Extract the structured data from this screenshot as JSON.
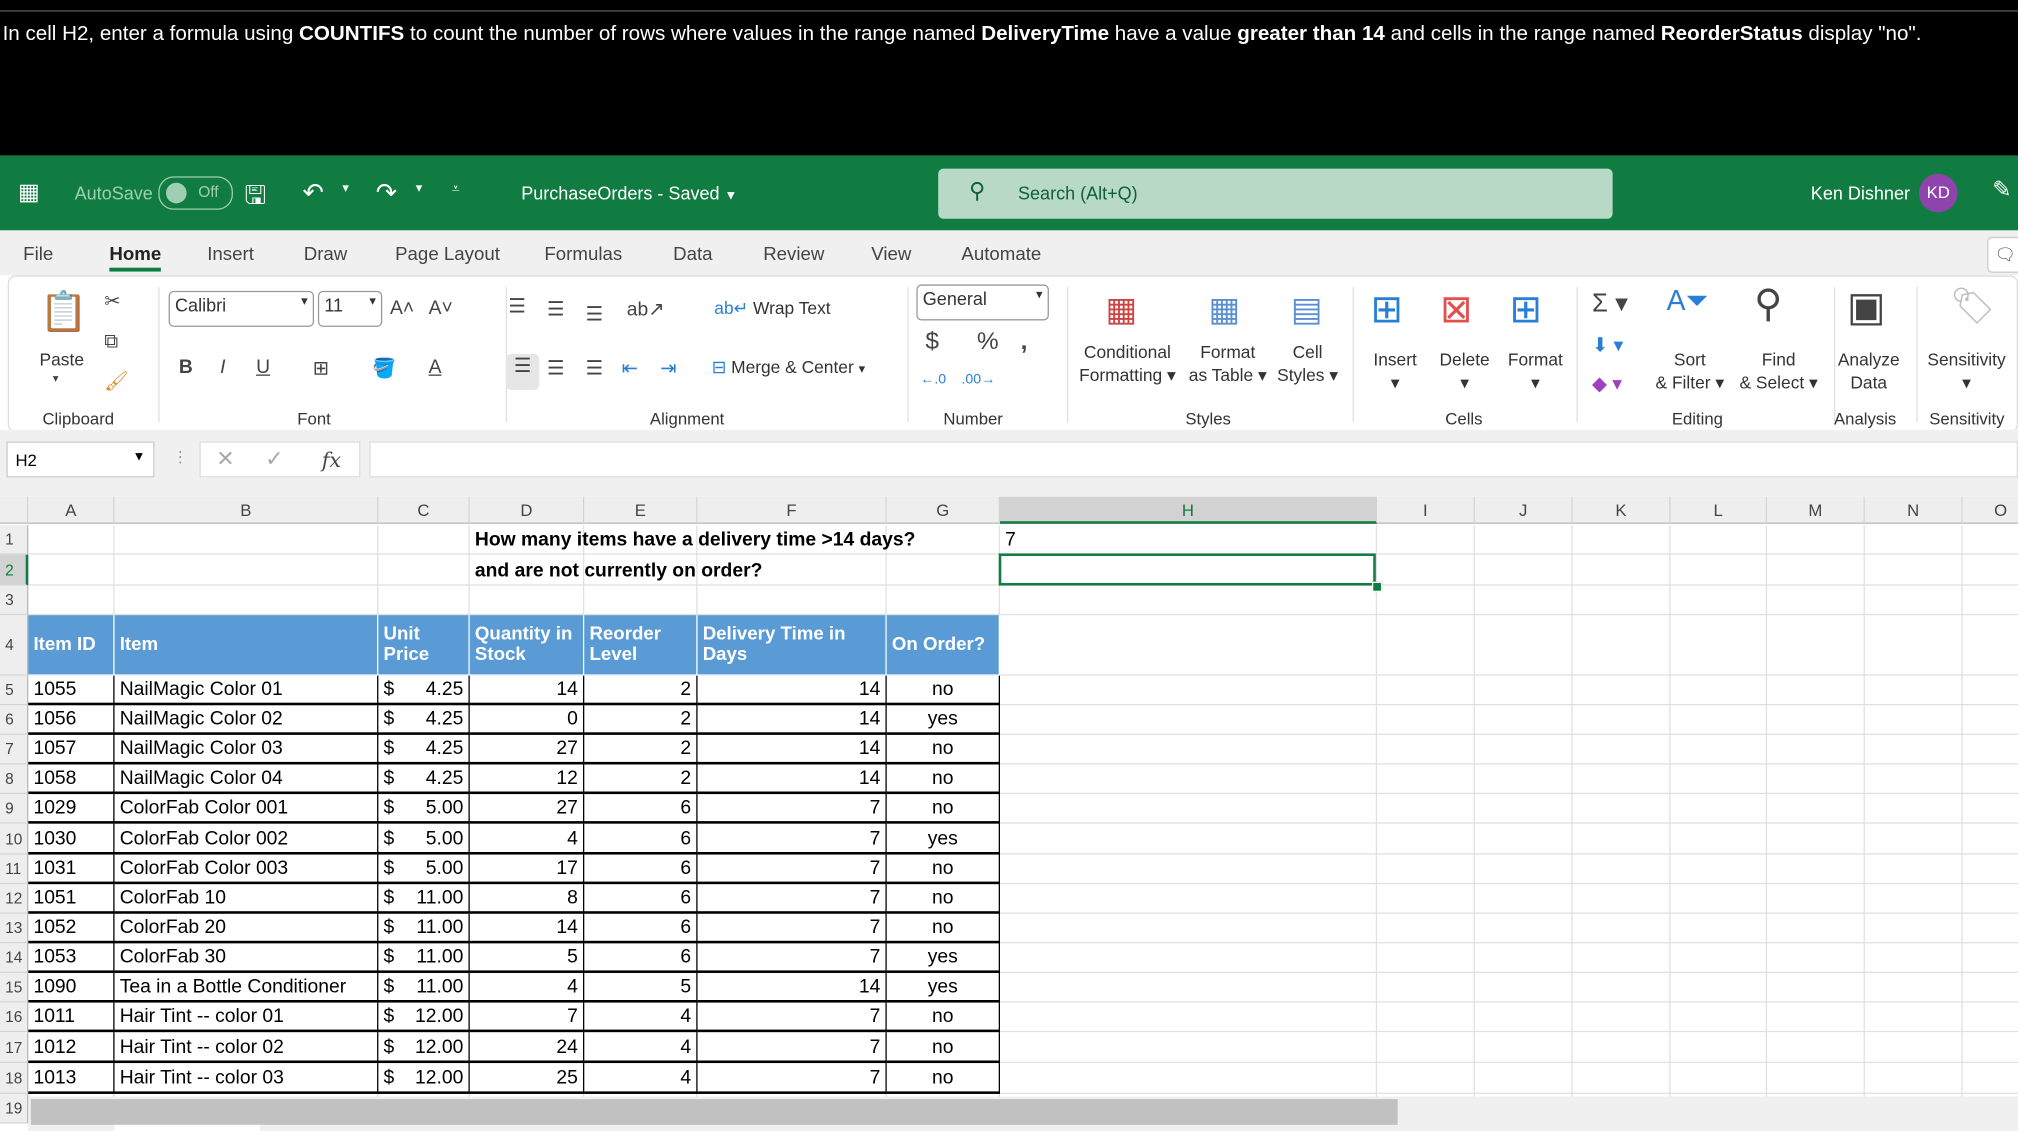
{
  "instruction": {
    "parts": [
      {
        "t": "In cell H2, enter a formula using ",
        "b": false
      },
      {
        "t": "COUNTIFS",
        "b": true
      },
      {
        "t": " to count the number of rows where values in the range named ",
        "b": false
      },
      {
        "t": "DeliveryTime",
        "b": true
      },
      {
        "t": " have a value ",
        "b": false
      },
      {
        "t": "greater than 14",
        "b": true
      },
      {
        "t": " and cells in the range named ",
        "b": false
      },
      {
        "t": "ReorderStatus",
        "b": true
      },
      {
        "t": " display \"no\".",
        "b": false
      }
    ]
  },
  "titlebar": {
    "autosave": "AutoSave",
    "autosave_state": "Off",
    "doc_title": "PurchaseOrders - Saved",
    "search_placeholder": "Search (Alt+Q)",
    "user": "Ken Dishner",
    "initials": "KD",
    "brand": "#107C41"
  },
  "tabs": [
    "File",
    "Home",
    "Insert",
    "Draw",
    "Page Layout",
    "Formulas",
    "Data",
    "Review",
    "View",
    "Automate"
  ],
  "active_tab": "Home",
  "ribbon": {
    "paste": "Paste",
    "font": "Calibri",
    "size": "11",
    "wrap": "Wrap Text",
    "merge": "Merge & Center",
    "numfmt": "General",
    "cond1": "Conditional",
    "cond2": "Formatting",
    "fat1": "Format",
    "fat2": "as Table",
    "cs1": "Cell",
    "cs2": "Styles",
    "insert": "Insert",
    "delete": "Delete",
    "format": "Format",
    "sort1": "Sort",
    "sort2": "& Filter",
    "find1": "Find",
    "find2": "& Select",
    "an1": "Analyze",
    "an2": "Data",
    "sens": "Sensitivity",
    "groups": {
      "clipboard": "Clipboard",
      "font": "Font",
      "alignment": "Alignment",
      "number": "Number",
      "styles": "Styles",
      "cells": "Cells",
      "editing": "Editing",
      "analysis": "Analysis",
      "sensitivity": "Sensitivity"
    }
  },
  "formula_bar": {
    "name_box": "H2",
    "fx": "fx",
    "value": ""
  },
  "columns": [
    "A",
    "B",
    "C",
    "D",
    "E",
    "F",
    "G",
    "H",
    "I",
    "J",
    "K",
    "L",
    "M",
    "N",
    "O"
  ],
  "selected_cell": "H2",
  "question": {
    "line1": "How many items have a delivery time >14 days?",
    "line2": "and are not currently on order?",
    "answer": "7"
  },
  "table": {
    "headers": [
      "Item ID",
      "Item",
      "Unit Price",
      "Quantity in Stock",
      "Reorder Level",
      "Delivery Time in Days",
      "On Order?"
    ],
    "rows": [
      [
        "1055",
        "NailMagic Color 01",
        "4.25",
        "14",
        "2",
        "14",
        "no"
      ],
      [
        "1056",
        "NailMagic Color 02",
        "4.25",
        "0",
        "2",
        "14",
        "yes"
      ],
      [
        "1057",
        "NailMagic Color 03",
        "4.25",
        "27",
        "2",
        "14",
        "no"
      ],
      [
        "1058",
        "NailMagic Color 04",
        "4.25",
        "12",
        "2",
        "14",
        "no"
      ],
      [
        "1029",
        "ColorFab Color 001",
        "5.00",
        "27",
        "6",
        "7",
        "no"
      ],
      [
        "1030",
        "ColorFab Color 002",
        "5.00",
        "4",
        "6",
        "7",
        "yes"
      ],
      [
        "1031",
        "ColorFab Color 003",
        "5.00",
        "17",
        "6",
        "7",
        "no"
      ],
      [
        "1051",
        "ColorFab 10",
        "11.00",
        "8",
        "6",
        "7",
        "no"
      ],
      [
        "1052",
        "ColorFab 20",
        "11.00",
        "14",
        "6",
        "7",
        "no"
      ],
      [
        "1053",
        "ColorFab 30",
        "11.00",
        "5",
        "6",
        "7",
        "yes"
      ],
      [
        "1090",
        "Tea in a Bottle Conditioner",
        "11.00",
        "4",
        "5",
        "14",
        "yes"
      ],
      [
        "1011",
        "Hair Tint -- color 01",
        "12.00",
        "7",
        "4",
        "7",
        "no"
      ],
      [
        "1012",
        "Hair Tint -- color 02",
        "12.00",
        "24",
        "4",
        "7",
        "no"
      ],
      [
        "1013",
        "Hair Tint -- color 03",
        "12.00",
        "25",
        "4",
        "7",
        "no"
      ]
    ],
    "currency": "$",
    "header_color": "#5B9BD5"
  }
}
